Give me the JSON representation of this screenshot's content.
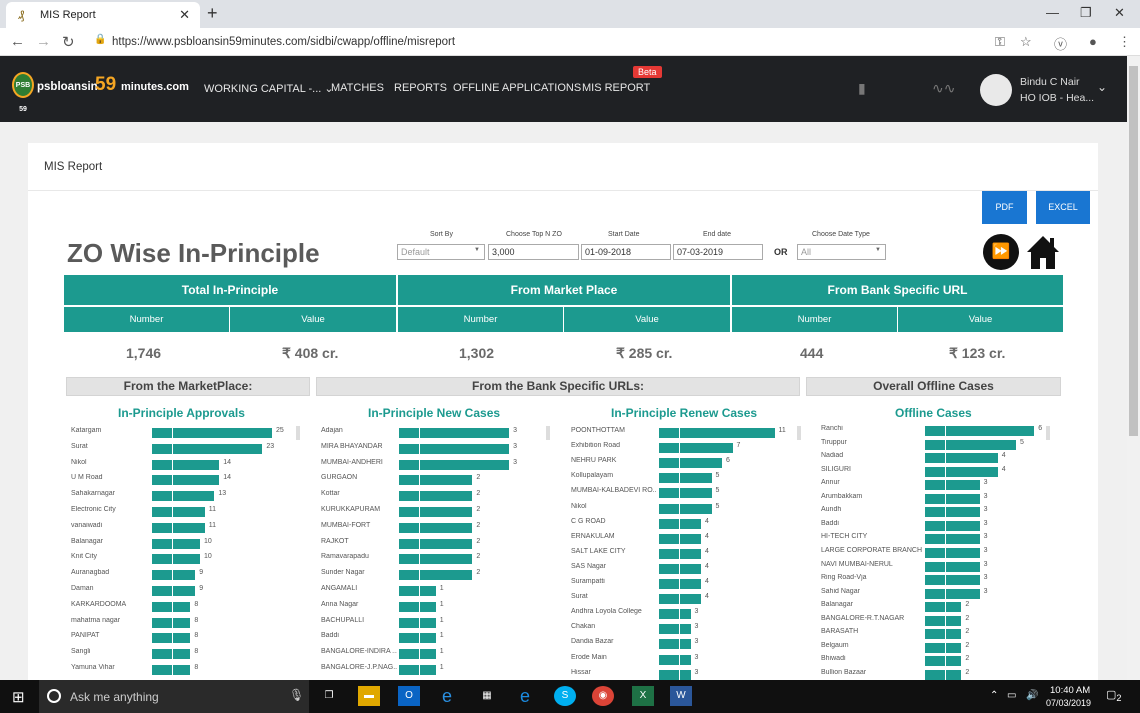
{
  "browser": {
    "tab_title": "MIS Report",
    "url": "https://www.psbloansin59minutes.com/sidbi/cwapp/offline/misreport"
  },
  "header": {
    "logo_text_1": "psbloansin",
    "logo_text_2": "59",
    "logo_text_3": "minutes.com",
    "logo_badge": "PSB 59",
    "nav": [
      "WORKING CAPITAL -...",
      "MATCHES",
      "REPORTS",
      "OFFLINE APPLICATIONS",
      "MIS REPORT"
    ],
    "beta": "Beta",
    "user_name": "Bindu C Nair",
    "user_role": "HO IOB - Hea..."
  },
  "page": {
    "card_title": "MIS Report",
    "pdf_label": "PDF",
    "excel_label": "EXCEL",
    "title": "ZO Wise In-Principle",
    "filters": {
      "sort_by_label": "Sort By",
      "sort_by_value": "Default",
      "top_n_label": "Choose Top N ZO",
      "top_n_value": "3,000",
      "start_label": "Start Date",
      "start_value": "01-09-2018",
      "end_label": "End date",
      "end_value": "07-03-2019",
      "or": "OR",
      "date_type_label": "Choose Date Type",
      "date_type_value": "All"
    }
  },
  "summary": {
    "groups": [
      "Total In-Principle",
      "From Market Place",
      "From Bank Specific URL"
    ],
    "sub_number": "Number",
    "sub_value": "Value",
    "values": [
      "1,746",
      "₹ 408 cr.",
      "1,302",
      "₹ 285 cr.",
      "444",
      "₹ 123 cr."
    ]
  },
  "sections": [
    "From the MarketPlace:",
    "From the Bank Specific URLs:",
    "Overall Offline Cases"
  ],
  "panels": [
    {
      "title": "In-Principle Approvals",
      "labels": [
        "Katargam",
        "Surat",
        "Nikol",
        "U M Road",
        "Sahakarnagar",
        "Electronic City",
        "vanaiwadi",
        "Balanagar",
        "Knit City",
        "Auranagbad",
        "Daman",
        "KARKARDOOMA",
        "mahatma nagar",
        "PANIPAT",
        "Sangli",
        "Yamuna Vihar"
      ],
      "values": [
        25,
        23,
        14,
        14,
        13,
        11,
        11,
        10,
        10,
        9,
        9,
        8,
        8,
        8,
        8,
        8
      ]
    },
    {
      "title": "In-Principle New Cases",
      "labels": [
        "Adajan",
        "MIRA BHAYANDAR",
        "MUMBAI-ANDHERI",
        "GURGAON",
        "Kottar",
        "KURUKKAPURAM",
        "MUMBAI-FORT",
        "RAJKOT",
        "Ramavarapadu",
        "Sunder Nagar",
        "ANGAMALI",
        "Anna Nagar",
        "BACHUPALLI",
        "Baddi",
        "BANGALORE-INDIRA ...",
        "BANGALORE-J.P.NAG..."
      ],
      "values": [
        3,
        3,
        3,
        2,
        2,
        2,
        2,
        2,
        2,
        2,
        1,
        1,
        1,
        1,
        1,
        1
      ]
    },
    {
      "title": "In-Principle Renew Cases",
      "labels": [
        "POONTHOTTAM",
        "Exhibition Road",
        "NEHRU PARK",
        "Kollupalayam",
        "MUMBAI-KALBADEVI RO...",
        "Nikol",
        "C G ROAD",
        "ERNAKULAM",
        "SALT LAKE CITY",
        "SAS Nagar",
        "Surampatti",
        "Surat",
        "Andhra Loyola College",
        "Chakan",
        "Dandia Bazar",
        "Erode Main",
        "Hissar"
      ],
      "values": [
        11,
        7,
        6,
        5,
        5,
        5,
        4,
        4,
        4,
        4,
        4,
        4,
        3,
        3,
        3,
        3,
        3
      ]
    },
    {
      "title": "Offline Cases",
      "labels": [
        "Ranchi",
        "Tiruppur",
        "Nadiad",
        "SILIGURI",
        "Annur",
        "Arumbakkam",
        "Aundh",
        "Baddi",
        "HI-TECH CITY",
        "LARGE CORPORATE BRANCH",
        "NAVI MUMBAI-NERUL",
        "Ring Road-Vja",
        "Sahid Nagar",
        "Balanagar",
        "BANGALORE-R.T.NAGAR",
        "BARASATH",
        "Belgaum",
        "Bhiwadi",
        "Bullion Bazaar"
      ],
      "values": [
        6,
        5,
        4,
        4,
        3,
        3,
        3,
        3,
        3,
        3,
        3,
        3,
        3,
        2,
        2,
        2,
        2,
        2,
        2
      ]
    }
  ],
  "taskbar": {
    "search_placeholder": "Ask me anything",
    "time": "10:40 AM",
    "date": "07/03/2019",
    "notifications": "2"
  },
  "colors": {
    "teal": "#1c9a8f",
    "button_blue": "#1976d2",
    "header_dark": "#1f2124",
    "beta_red": "#e53935"
  }
}
